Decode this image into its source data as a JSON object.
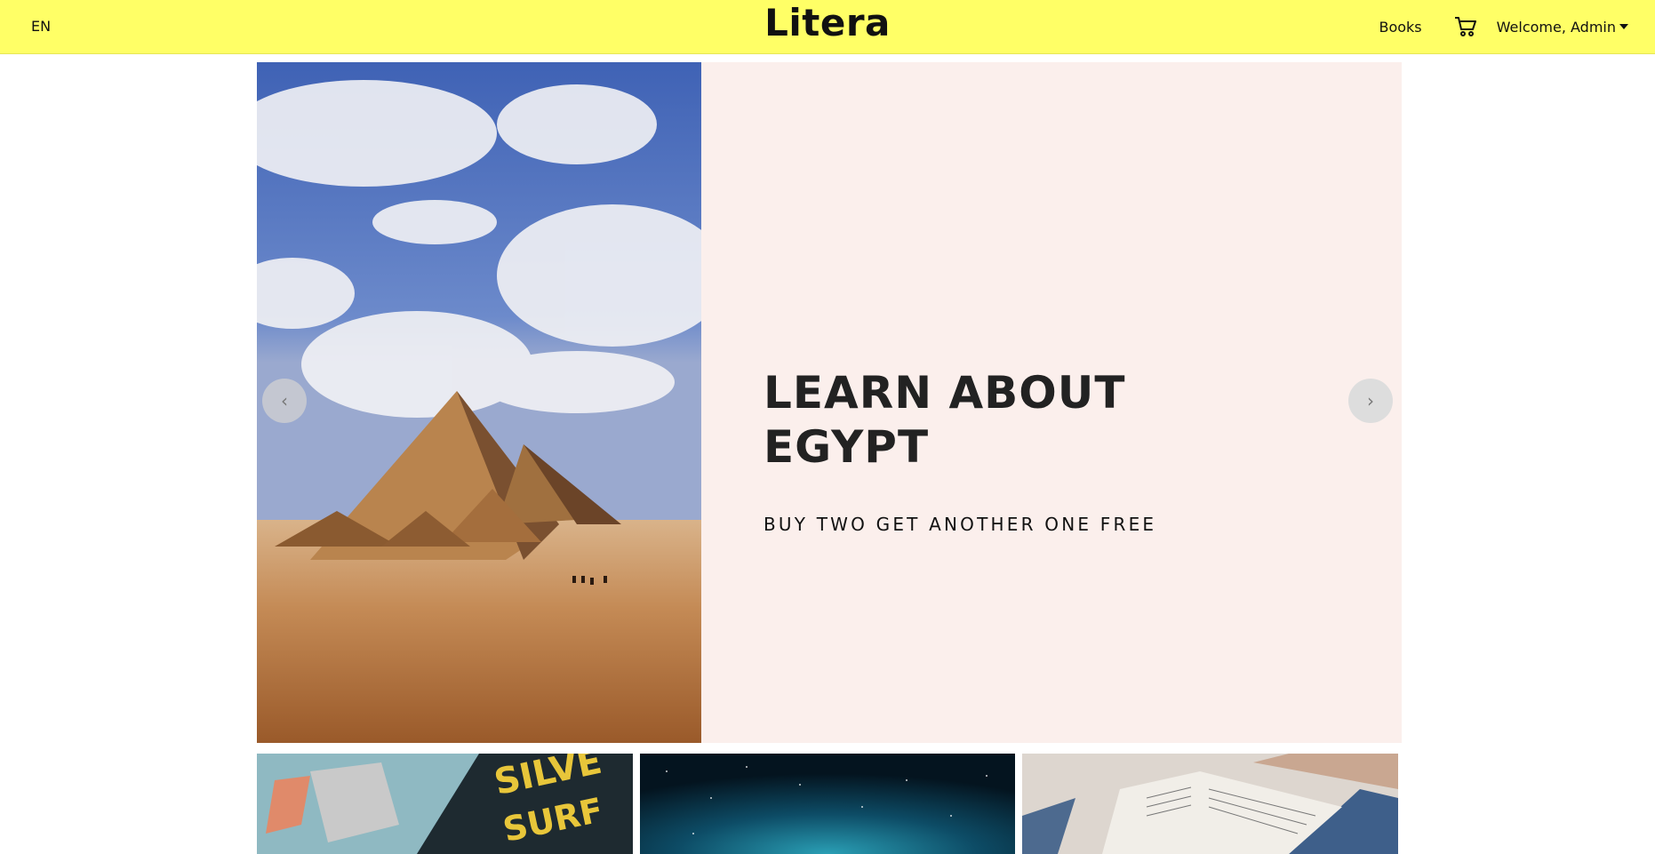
{
  "nav": {
    "language": "EN",
    "brand": "Litera",
    "books_link": "Books",
    "cart_icon": "cart-icon",
    "user_menu": "Welcome, Admin"
  },
  "hero": {
    "title": "LEARN ABOUT EGYPT",
    "subtitle": "BUY TWO GET ANOTHER ONE FREE",
    "background_color": "#fbefec",
    "prev_icon": "chevron-left-icon",
    "next_icon": "chevron-right-icon",
    "image": "pyramids-photo"
  },
  "tiles": [
    {
      "image": "comic-books-photo"
    },
    {
      "image": "starry-sky-photo"
    },
    {
      "image": "reading-book-photo"
    }
  ],
  "colors": {
    "navbar": "#ffff66"
  }
}
